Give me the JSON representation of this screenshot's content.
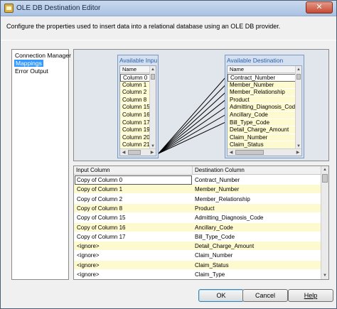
{
  "window": {
    "title": "OLE DB Destination Editor",
    "close_label": "✕"
  },
  "description": "Configure the properties used to insert data into a relational database using an OLE DB provider.",
  "nav": {
    "items": [
      {
        "label": "Connection Manager",
        "selected": false
      },
      {
        "label": "Mappings",
        "selected": true
      },
      {
        "label": "Error Output",
        "selected": false
      }
    ]
  },
  "input_table": {
    "title": "Available Inpu",
    "header": "Name",
    "rows": [
      "Column 0",
      "Column 1",
      "Column 2",
      "Column 8",
      "Column 15",
      "Column 16",
      "Column 17",
      "Column 19",
      "Column 20",
      "Column 21"
    ]
  },
  "dest_table": {
    "title": "Available Destination Columns",
    "header": "Name",
    "rows": [
      "Contract_Number",
      "Member_Number",
      "Member_Relationship",
      "Product",
      "Admitting_Diagnosis_Code",
      "Ancillary_Code",
      "Bill_Type_Code",
      "Detail_Charge_Amount",
      "Claim_Number",
      "Claim_Status"
    ]
  },
  "grid": {
    "headers": {
      "input": "Input Column",
      "destination": "Destination Column"
    },
    "rows": [
      {
        "input": "Copy of Column 0",
        "destination": "Contract_Number"
      },
      {
        "input": "Copy of Column 1",
        "destination": "Member_Number"
      },
      {
        "input": "Copy of Column 2",
        "destination": "Member_Relationship"
      },
      {
        "input": "Copy of Column 8",
        "destination": "Product"
      },
      {
        "input": "Copy of Column 15",
        "destination": "Admitting_Diagnosis_Code"
      },
      {
        "input": "Copy of Column 16",
        "destination": "Ancillary_Code"
      },
      {
        "input": "Copy of Column 17",
        "destination": "Bill_Type_Code"
      },
      {
        "input": "<ignore>",
        "destination": "Detail_Charge_Amount"
      },
      {
        "input": "<ignore>",
        "destination": "Claim_Number"
      },
      {
        "input": "<ignore>",
        "destination": "Claim_Status"
      },
      {
        "input": "<ignore>",
        "destination": "Claim_Type"
      }
    ]
  },
  "buttons": {
    "ok": "OK",
    "cancel": "Cancel",
    "help": "Help"
  },
  "icons": {
    "app": "ole-db-destination-icon",
    "close": "close-icon"
  },
  "colors": {
    "selection": "#3399ff",
    "row_highlight": "#fefad0",
    "table_title": "#2a5fa8"
  }
}
